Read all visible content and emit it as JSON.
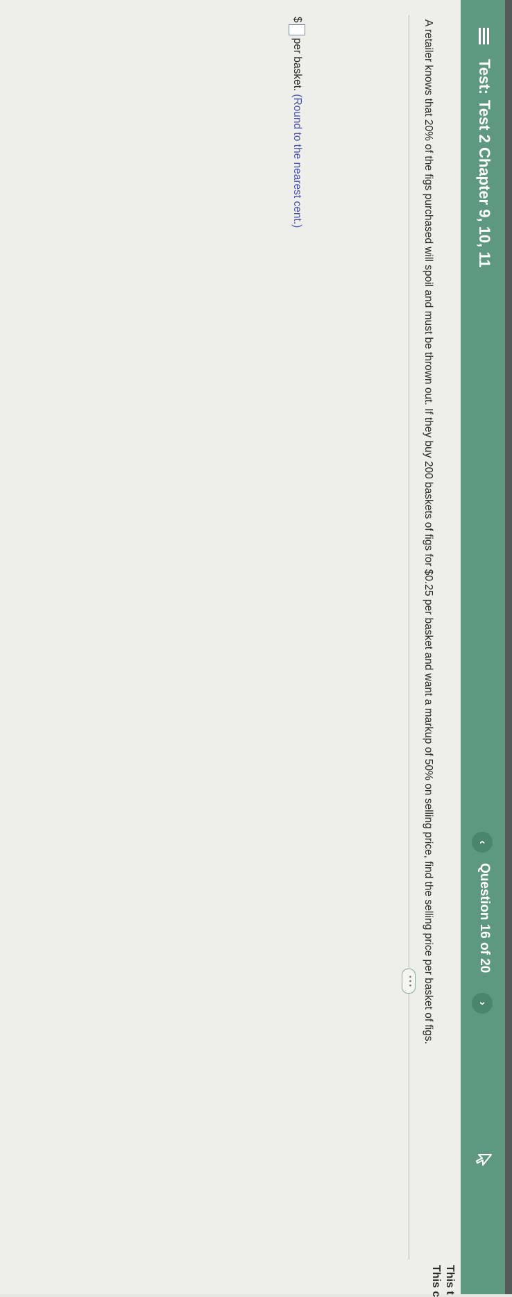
{
  "header": {
    "test_prefix": "Test:",
    "test_title": "Test 2 Chapter 9, 10, 11",
    "question_counter": "Question 16 of 20",
    "prev_glyph": "‹",
    "next_glyph": "›",
    "right_line_1": "This t",
    "right_line_2": "This c"
  },
  "icons": [
    "menu-icon",
    "chevron-left-icon",
    "chevron-right-icon",
    "pointer-icon"
  ],
  "question": {
    "text": "A retailer knows that 20% of the figs purchased will spoil and must be thrown out. If they buy 200 baskets of figs for $0.25 per basket and want a markup of 50% on selling price, find the selling price per basket of figs.",
    "more_label": "• • •"
  },
  "answer": {
    "currency": "$",
    "value": "",
    "unit": "per basket.",
    "note": "(Round to the nearest cent.)"
  },
  "colors": {
    "header": "#5e9880",
    "header_text": "#ffffff",
    "note_text": "#4a55a8",
    "background": "#eeefea"
  }
}
